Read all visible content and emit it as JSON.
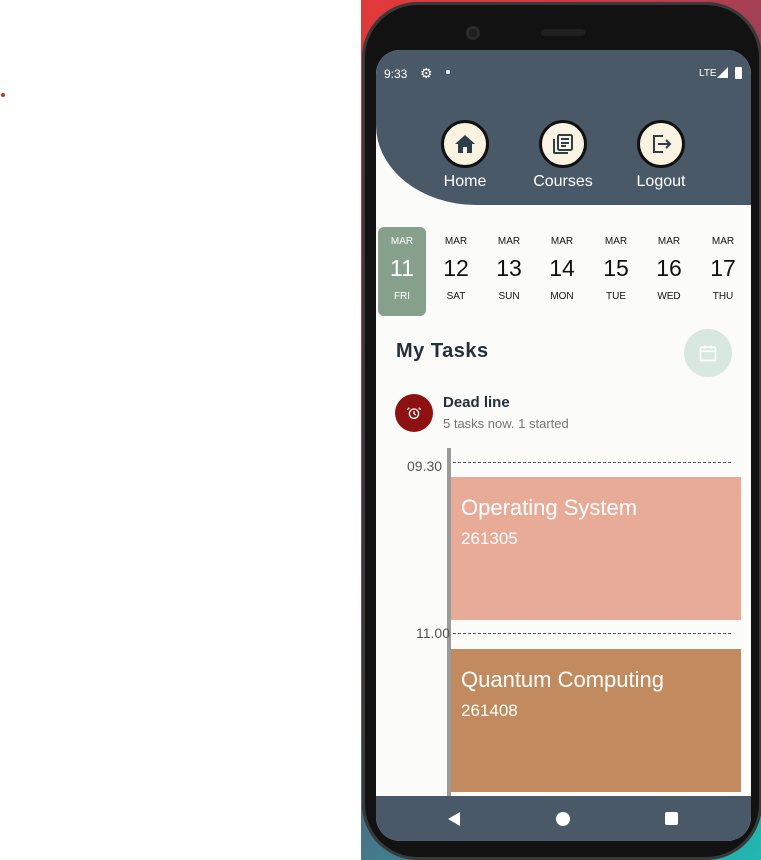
{
  "status_bar": {
    "time": "9:33",
    "network": "LTE"
  },
  "nav": [
    {
      "label": "Home",
      "icon": "home-icon"
    },
    {
      "label": "Courses",
      "icon": "courses-icon"
    },
    {
      "label": "Logout",
      "icon": "logout-icon"
    }
  ],
  "calendar": [
    {
      "month": "MAR",
      "day": "11",
      "weekday": "FRI",
      "selected": true
    },
    {
      "month": "MAR",
      "day": "12",
      "weekday": "SAT"
    },
    {
      "month": "MAR",
      "day": "13",
      "weekday": "SUN"
    },
    {
      "month": "MAR",
      "day": "14",
      "weekday": "MON"
    },
    {
      "month": "MAR",
      "day": "15",
      "weekday": "TUE"
    },
    {
      "month": "MAR",
      "day": "16",
      "weekday": "WED"
    },
    {
      "month": "MAR",
      "day": "17",
      "weekday": "THU"
    }
  ],
  "tasks": {
    "title": "My Tasks",
    "deadline": {
      "title": "Dead line",
      "subtitle": "5 tasks now. 1 started"
    }
  },
  "timeline": {
    "times": [
      "09.30",
      "11.00"
    ],
    "events": [
      {
        "title": "Operating System",
        "code": "261305",
        "color": "#e8ab98"
      },
      {
        "title": "Quantum Computing",
        "code": "261408",
        "color": "#c18b5f"
      }
    ]
  },
  "colors": {
    "header": "#4a5967",
    "selected_day": "#86a08c",
    "deadline_badge": "#8e1111",
    "calendar_button": "#d8e7df"
  }
}
